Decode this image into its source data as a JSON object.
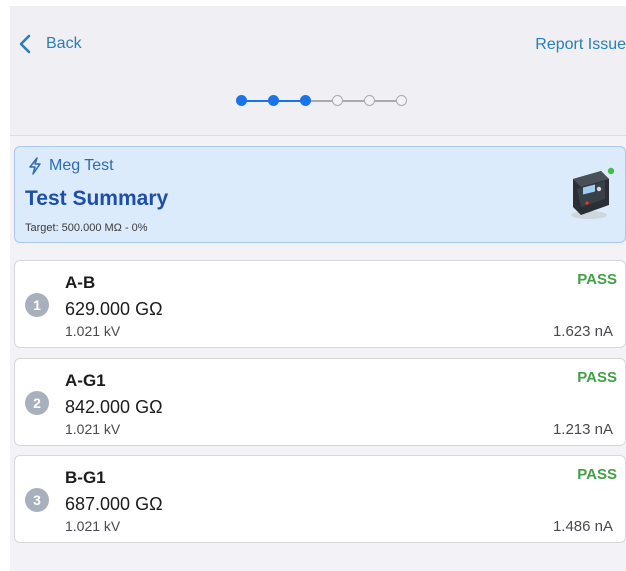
{
  "nav": {
    "back_label": "Back",
    "report_label": "Report Issue"
  },
  "stepper": {
    "total_steps": 6,
    "completed_steps": 3
  },
  "summary": {
    "test_type": "Meg Test",
    "title": "Test Summary",
    "target": "Target: 500.000 MΩ - 0%"
  },
  "results": [
    {
      "index": "1",
      "name": "A-B",
      "resistance": "629.000 GΩ",
      "voltage": "1.021 kV",
      "status": "PASS",
      "current": "1.623 nA"
    },
    {
      "index": "2",
      "name": "A-G1",
      "resistance": "842.000 GΩ",
      "voltage": "1.021 kV",
      "status": "PASS",
      "current": "1.213 nA"
    },
    {
      "index": "3",
      "name": "B-G1",
      "resistance": "687.000 GΩ",
      "voltage": "1.021 kV",
      "status": "PASS",
      "current": "1.486 nA"
    }
  ],
  "colors": {
    "accent": "#1a73e8",
    "link": "#2b7fb7",
    "pass": "#43a047",
    "summary_bg": "#dcebfb"
  },
  "icons": {
    "back": "chevron-left-icon",
    "test_type": "lightning-icon",
    "device": "megohmmeter-device-icon"
  }
}
